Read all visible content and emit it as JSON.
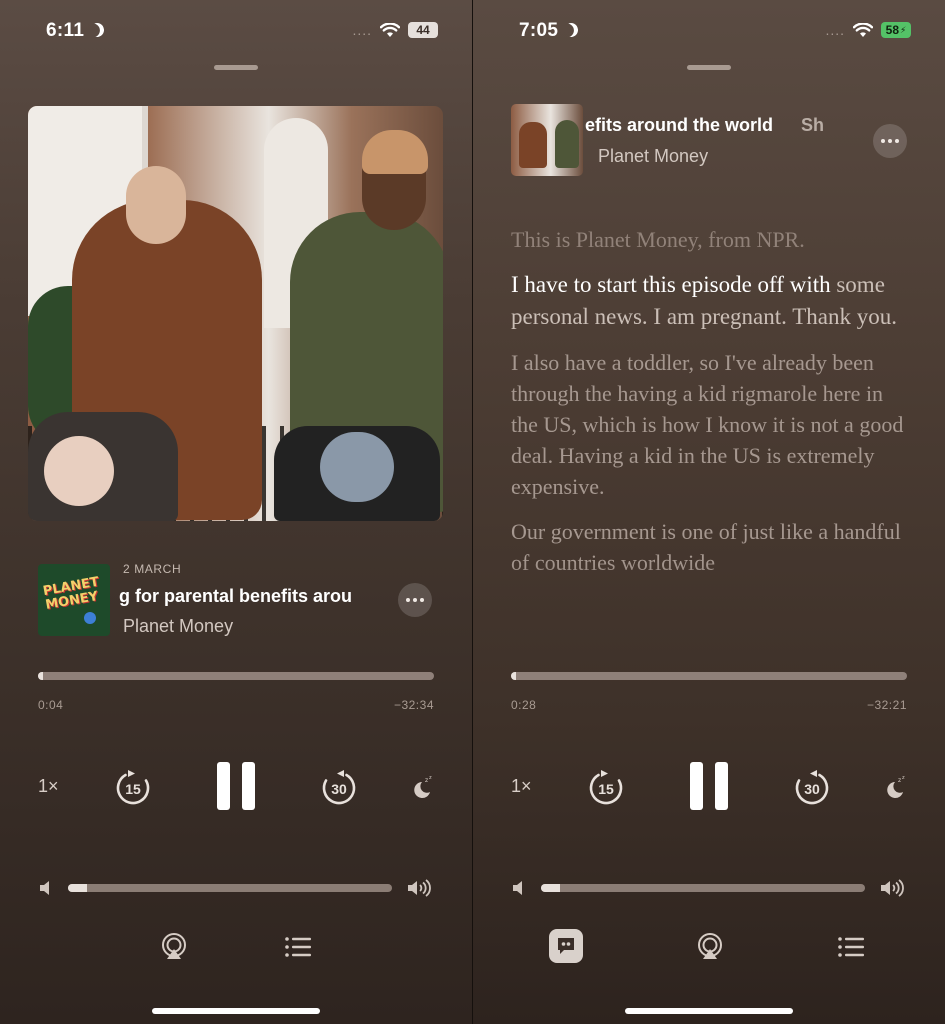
{
  "left": {
    "status": {
      "time": "6:11",
      "battery": "44",
      "dots": "...."
    },
    "episode": {
      "date": "2 MARCH",
      "title": "g for parental benefits arou",
      "show": "Planet Money",
      "artwork_logo": "PLANET MONEY"
    },
    "playback": {
      "elapsed": "0:04",
      "remaining": "−32:34",
      "progress": 0.002,
      "speed": "1×",
      "skip_back": "15",
      "skip_forward": "30"
    },
    "volume": {
      "level": 0.06
    }
  },
  "right": {
    "status": {
      "time": "7:05",
      "battery": "58",
      "dots": "...."
    },
    "episode": {
      "title": "efits around the world",
      "title_next": "Sh",
      "show": "Planet Money"
    },
    "transcript": {
      "p1": "This is Planet Money, from NPR.",
      "p2_spoken": "I have to start this episode off with",
      "p2_rest": " some personal news. I am pregnant. Thank you.",
      "p3": "I also have a toddler, so I've already been through the having a kid rigmarole here in the US, which is how I know it is not a good deal. Having a kid in the US is extremely expensive.",
      "p4": "Our government is one of just like a handful of countries worldwide"
    },
    "playback": {
      "elapsed": "0:28",
      "remaining": "−32:21",
      "progress": 0.004,
      "speed": "1×",
      "skip_back": "15",
      "skip_forward": "30"
    },
    "volume": {
      "level": 0.06
    }
  },
  "colors": {
    "accent": "#ffffff",
    "battery_green": "#54c267",
    "background": "#4a3c34"
  }
}
